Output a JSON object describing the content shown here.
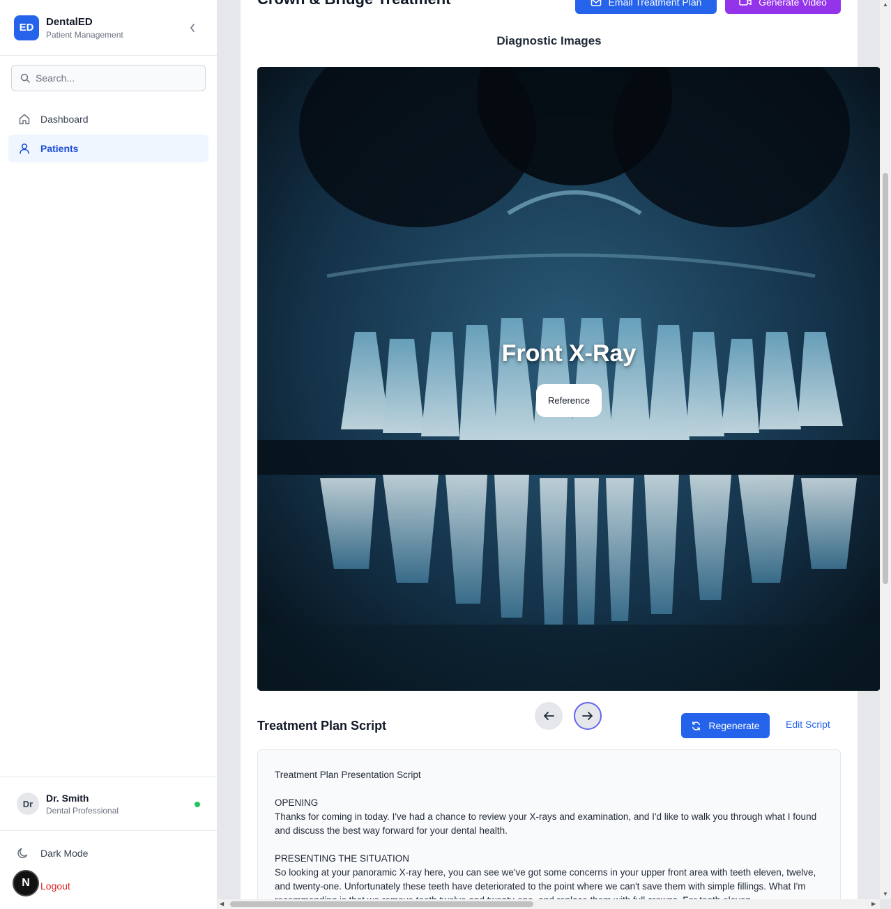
{
  "brand": {
    "logo": "ED",
    "name": "DentalED",
    "subtitle": "Patient Management"
  },
  "search": {
    "placeholder": "Search..."
  },
  "nav": {
    "items": [
      {
        "label": "Dashboard",
        "icon": "home-icon",
        "active": false
      },
      {
        "label": "Patients",
        "icon": "user-icon",
        "active": true
      }
    ]
  },
  "user": {
    "initials": "Dr",
    "name": "Dr. Smith",
    "role": "Dental Professional",
    "status_color": "#22c55e"
  },
  "footer": {
    "dark_mode": "Dark Mode",
    "logout": "Logout",
    "badge": "N"
  },
  "header": {
    "title": "Crown & Bridge Treatment",
    "email_button": "Email Treatment Plan",
    "video_button": "Generate Video"
  },
  "diagnostic": {
    "title": "Diagnostic Images",
    "image_caption": "Front X-Ray",
    "reference_button": "Reference"
  },
  "script": {
    "title": "Treatment Plan Script",
    "regenerate_button": "Regenerate",
    "edit_button": "Edit Script",
    "heading": "Treatment Plan Presentation Script",
    "opening_title": "OPENING",
    "opening_text": "Thanks for coming in today. I've had a chance to review your X-rays and examination, and I'd like to walk you through what I found and discuss the best way forward for your dental health.",
    "situation_title": "PRESENTING THE SITUATION",
    "situation_text": "So looking at your panoramic X-ray here, you can see we've got some concerns in your upper front area with teeth eleven, twelve, and twenty-one. Unfortunately these teeth have deteriorated to the point where we can't save them with simple fillings. What I'm recommending is that we remove tooth twelve and twenty-one, and replace them with full crowns. For tooth eleven..."
  },
  "colors": {
    "primary": "#2563eb",
    "purple": "#9333ea",
    "danger": "#dc2626",
    "active_bg": "#eff6ff"
  }
}
